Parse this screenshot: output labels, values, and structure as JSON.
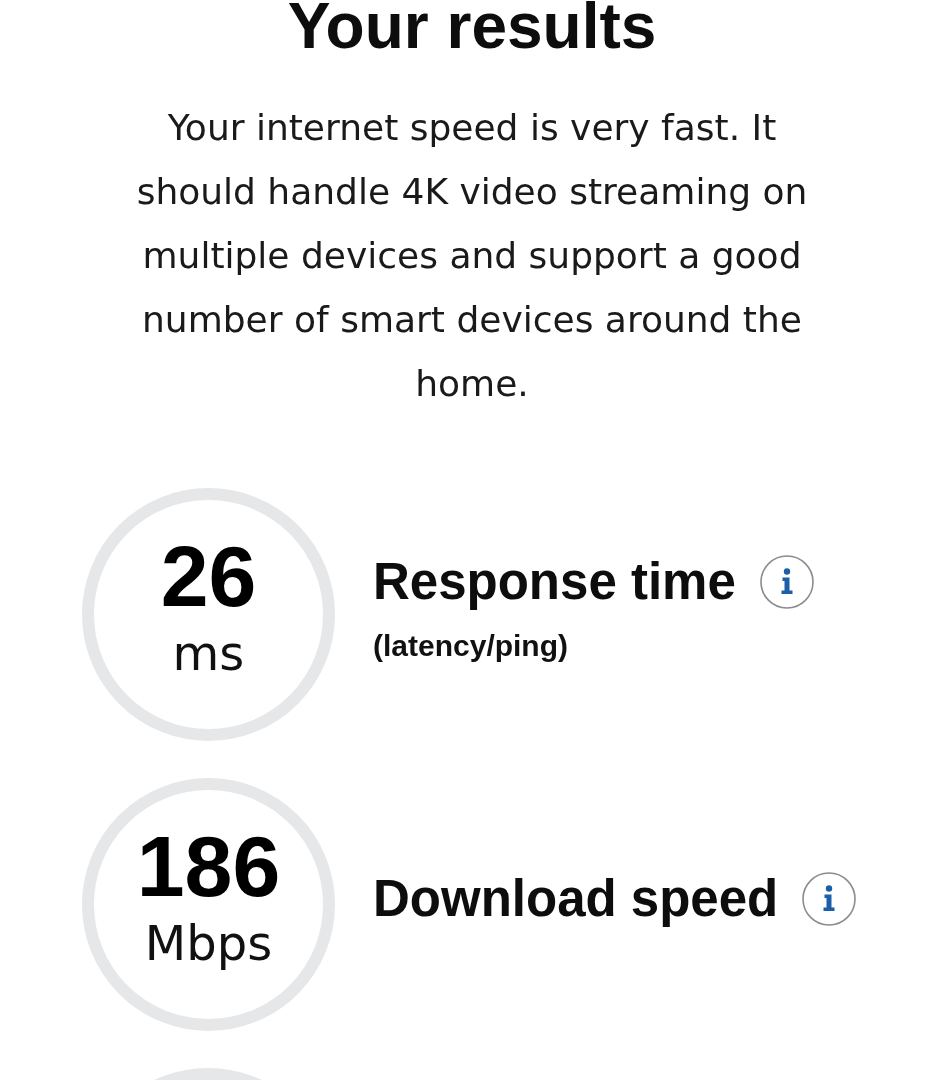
{
  "title": "Your results",
  "summary": "Your internet speed is very fast. It should handle 4K video streaming on multiple devices and support a good number of smart devices around the home.",
  "metrics": [
    {
      "value": "26",
      "unit": "ms",
      "label": "Response time",
      "note": "(latency/ping)"
    },
    {
      "value": "186",
      "unit": "Mbps",
      "label": "Download speed"
    }
  ]
}
